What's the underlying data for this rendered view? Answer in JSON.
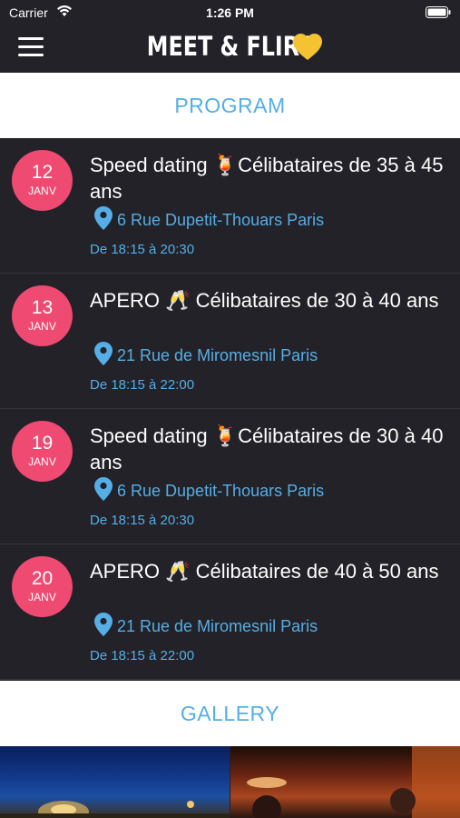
{
  "status_bar": {
    "carrier": "Carrier",
    "time": "1:26 PM"
  },
  "nav": {
    "title": "MEET & FLIRT",
    "icons": [
      "menu-icon",
      "yellow-heart-icon"
    ]
  },
  "program": {
    "header": "PROGRAM"
  },
  "events": [
    {
      "day": "12",
      "month": "JANV",
      "title": "Speed dating 🍹Célibataires de 35 à 45 ans",
      "location": "6 Rue Dupetit-Thouars Paris",
      "time": "De 18:15 à 20:30"
    },
    {
      "day": "13",
      "month": "JANV",
      "title": "APERO 🥂 Célibataires de 30 à 40 ans",
      "location": "21 Rue de Miromesnil Paris",
      "time": "De 18:15 à 22:00"
    },
    {
      "day": "19",
      "month": "JANV",
      "title": "Speed dating 🍹Célibataires de 30 à 40 ans",
      "location": "6 Rue Dupetit-Thouars Paris",
      "time": "De 18:15 à 20:30"
    },
    {
      "day": "20",
      "month": "JANV",
      "title": "APERO 🥂 Célibataires de 40 à 50 ans",
      "location": "21 Rue de Miromesnil Paris",
      "time": "De 18:15 à 22:00"
    }
  ],
  "gallery": {
    "header": "GALLERY"
  },
  "colors": {
    "background": "#232228",
    "accent_blue": "#55aee6",
    "date_badge_pink": "#ef4a72",
    "heart_yellow": "#f5c232"
  }
}
